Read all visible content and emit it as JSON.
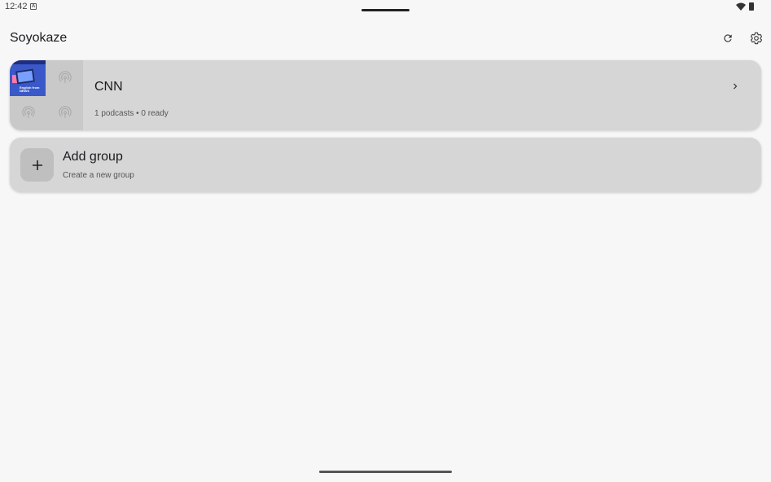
{
  "status_bar": {
    "time": "12:42",
    "notif_letter": "A"
  },
  "app_bar": {
    "title": "Soyokaze"
  },
  "groups": [
    {
      "title": "CNN",
      "subtitle": "1 podcasts • 0 ready"
    }
  ],
  "add_group": {
    "title": "Add group",
    "subtitle": "Create a new group",
    "icon": "plus-icon"
  },
  "thumbnail": {
    "art_text": "English from NEWS"
  },
  "icons": [
    "refresh-icon",
    "settings-icon",
    "chevron-right-icon",
    "podcast-icon",
    "wifi-icon",
    "battery-icon"
  ],
  "colors": {
    "background": "#f7f7f7",
    "card": "#d6d6d6",
    "art_blue": "#3a58c8"
  }
}
